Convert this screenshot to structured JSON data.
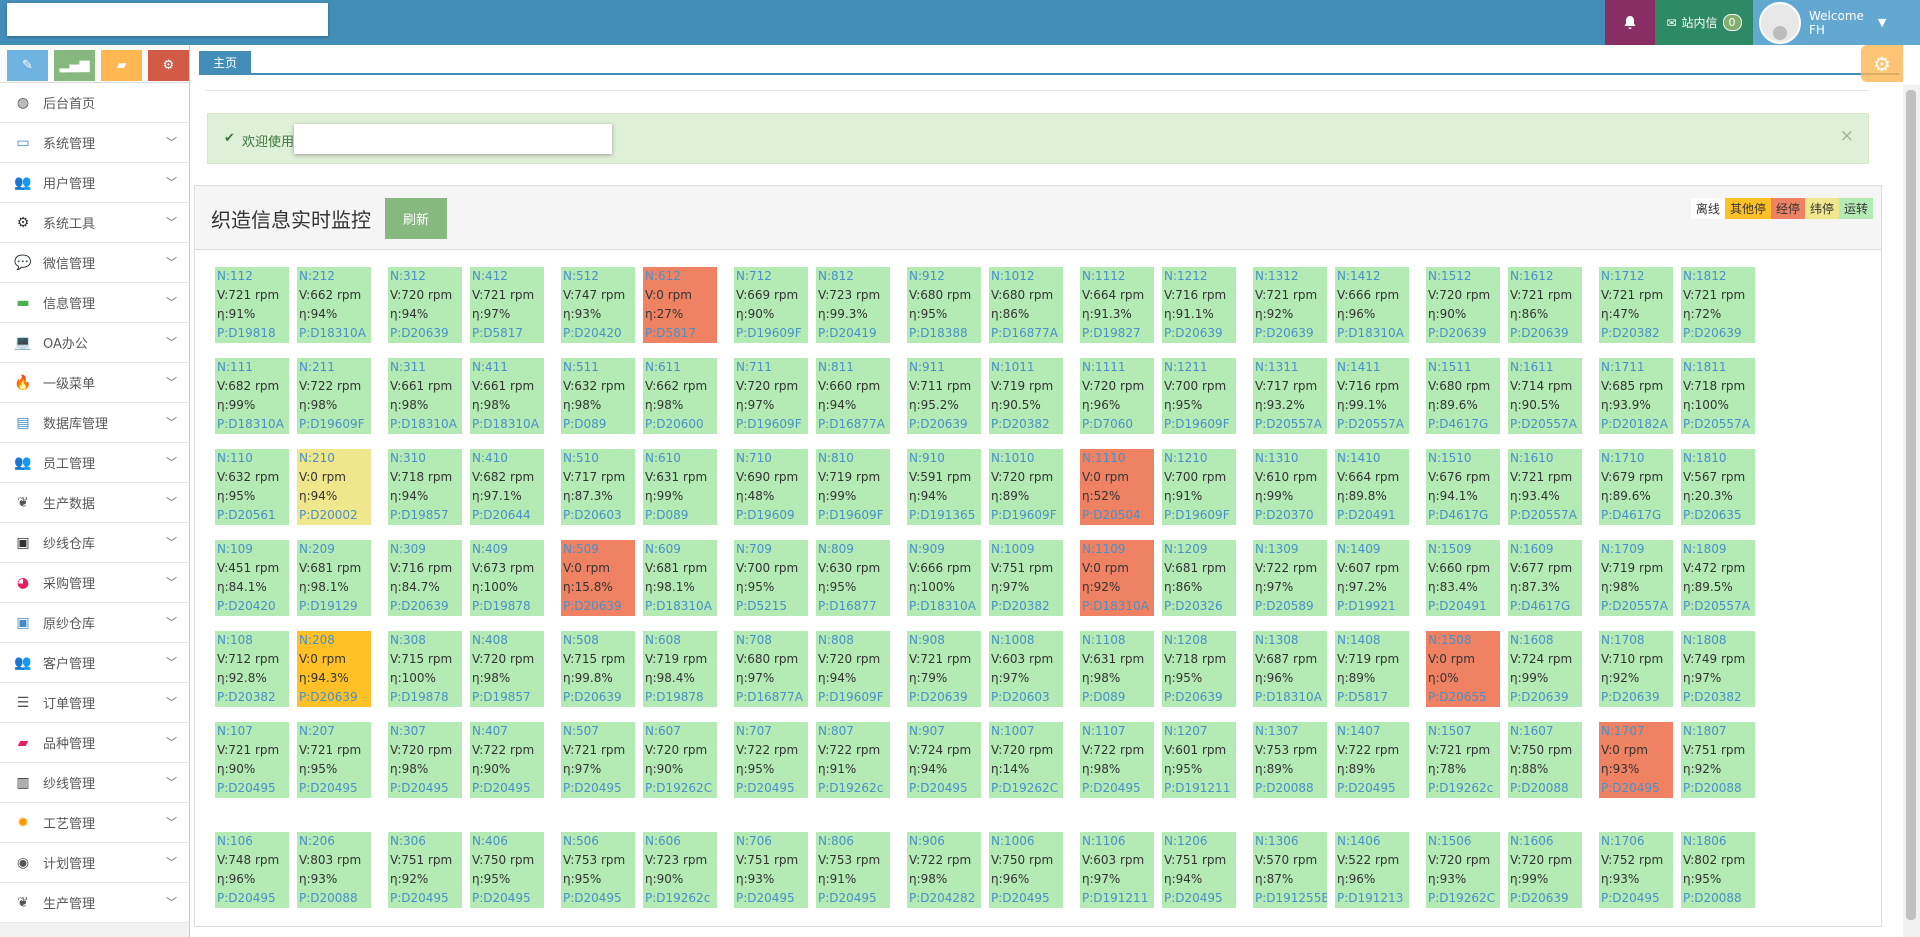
{
  "colors": {
    "normal": "#b4ebb4",
    "stopped": "#f08264",
    "yellow": "#f0e68c",
    "orange": "#ffc125",
    "gray": "#eeeeee"
  },
  "nav": {
    "message_label": "站内信",
    "message_count": "0",
    "welcome": "Welcome",
    "user": "FH"
  },
  "tab": {
    "home": "主页"
  },
  "alert": {
    "text": "欢迎使用"
  },
  "panel": {
    "title": "织造信息实时监控",
    "refresh": "刷新"
  },
  "legend": [
    {
      "label": "离线",
      "color": "#ffffff"
    },
    {
      "label": "其他停",
      "color": "#ffc125"
    },
    {
      "label": "经停",
      "color": "#f08264"
    },
    {
      "label": "纬停",
      "color": "#f0e68c"
    },
    {
      "label": "运转",
      "color": "#b4ebb4"
    }
  ],
  "sidebar": {
    "items": [
      {
        "label": "后台首页",
        "icon": "dashboard-icon",
        "glyph": "◍",
        "color": "#555",
        "caret": false
      },
      {
        "label": "系统管理",
        "icon": "desktop-icon",
        "glyph": "▭",
        "color": "#428bca",
        "caret": true
      },
      {
        "label": "用户管理",
        "icon": "users-icon",
        "glyph": "👥",
        "color": "#428bca",
        "caret": true
      },
      {
        "label": "系统工具",
        "icon": "cog-icon",
        "glyph": "⚙",
        "color": "#333",
        "caret": true
      },
      {
        "label": "微信管理",
        "icon": "comments-icon",
        "glyph": "💬",
        "color": "#8b5fbf",
        "caret": true
      },
      {
        "label": "信息管理",
        "icon": "credit-card-icon",
        "glyph": "▬",
        "color": "#4caf50",
        "caret": true
      },
      {
        "label": "OA办公",
        "icon": "laptop-icon",
        "glyph": "💻",
        "color": "#e91e63",
        "caret": true
      },
      {
        "label": "一级菜单",
        "icon": "fire-icon",
        "glyph": "🔥",
        "color": "#ff5722",
        "caret": true
      },
      {
        "label": "数据库管理",
        "icon": "hdd-icon",
        "glyph": "▤",
        "color": "#428bca",
        "caret": true
      },
      {
        "label": "员工管理",
        "icon": "users-icon",
        "glyph": "👥",
        "color": "#428bca",
        "caret": true
      },
      {
        "label": "生产数据",
        "icon": "leaf-icon",
        "glyph": "❦",
        "color": "#555",
        "caret": true
      },
      {
        "label": "纱线仓库",
        "icon": "briefcase-icon",
        "glyph": "▣",
        "color": "#333",
        "caret": true
      },
      {
        "label": "采购管理",
        "icon": "palette-icon",
        "glyph": "◕",
        "color": "#e91e63",
        "caret": true
      },
      {
        "label": "原纱仓库",
        "icon": "briefcase-icon",
        "glyph": "▣",
        "color": "#428bca",
        "caret": true
      },
      {
        "label": "客户管理",
        "icon": "users-icon",
        "glyph": "👥",
        "color": "#e91e63",
        "caret": true
      },
      {
        "label": "订单管理",
        "icon": "file-icon",
        "glyph": "☰",
        "color": "#555",
        "caret": true
      },
      {
        "label": "品种管理",
        "icon": "book-icon",
        "glyph": "▰",
        "color": "#e91e63",
        "caret": true
      },
      {
        "label": "纱线管理",
        "icon": "barcode-icon",
        "glyph": "▥",
        "color": "#333",
        "caret": true
      },
      {
        "label": "工艺管理",
        "icon": "gear-orange-icon",
        "glyph": "✹",
        "color": "#ff9800",
        "caret": true
      },
      {
        "label": "计划管理",
        "icon": "globe-icon",
        "glyph": "◉",
        "color": "#555",
        "caret": true
      },
      {
        "label": "生产管理",
        "icon": "leaf-icon",
        "glyph": "❦",
        "color": "#555",
        "caret": true
      }
    ]
  },
  "machines": [
    [
      [
        "N:112",
        "V:721 rpm",
        "η:91%",
        "P:D19818",
        "normal"
      ],
      [
        "N:212",
        "V:662 rpm",
        "η:94%",
        "P:D18310A",
        "normal"
      ],
      [
        "N:312",
        "V:720 rpm",
        "η:94%",
        "P:D20639",
        "normal"
      ],
      [
        "N:412",
        "V:721 rpm",
        "η:97%",
        "P:D5817",
        "normal"
      ],
      [
        "N:512",
        "V:747 rpm",
        "η:93%",
        "P:D20420",
        "normal"
      ],
      [
        "N:612",
        "V:0 rpm",
        "η:27%",
        "P:D5817",
        "stopped"
      ],
      [
        "N:712",
        "V:669 rpm",
        "η:90%",
        "P:D19609F",
        "normal"
      ],
      [
        "N:812",
        "V:723 rpm",
        "η:99.3%",
        "P:D20419",
        "normal"
      ],
      [
        "N:912",
        "V:680 rpm",
        "η:95%",
        "P:D18388",
        "normal"
      ],
      [
        "N:1012",
        "V:680 rpm",
        "η:86%",
        "P:D16877A",
        "normal"
      ],
      [
        "N:1112",
        "V:664 rpm",
        "η:91.3%",
        "P:D19827",
        "normal"
      ],
      [
        "N:1212",
        "V:716 rpm",
        "η:91.1%",
        "P:D20639",
        "normal"
      ],
      [
        "N:1312",
        "V:721 rpm",
        "η:92%",
        "P:D20639",
        "normal"
      ],
      [
        "N:1412",
        "V:666 rpm",
        "η:96%",
        "P:D18310A",
        "normal"
      ],
      [
        "N:1512",
        "V:720 rpm",
        "η:90%",
        "P:D20639",
        "normal"
      ],
      [
        "N:1612",
        "V:721 rpm",
        "η:86%",
        "P:D20639",
        "normal"
      ],
      [
        "N:1712",
        "V:721 rpm",
        "η:47%",
        "P:D20382",
        "normal"
      ],
      [
        "N:1812",
        "V:721 rpm",
        "η:72%",
        "P:D20639",
        "normal"
      ]
    ],
    [
      [
        "N:111",
        "V:682 rpm",
        "η:99%",
        "P:D18310A",
        "normal"
      ],
      [
        "N:211",
        "V:722 rpm",
        "η:98%",
        "P:D19609F",
        "normal"
      ],
      [
        "N:311",
        "V:661 rpm",
        "η:98%",
        "P:D18310A",
        "normal"
      ],
      [
        "N:411",
        "V:661 rpm",
        "η:98%",
        "P:D18310A",
        "normal"
      ],
      [
        "N:511",
        "V:632 rpm",
        "η:98%",
        "P:D089",
        "normal"
      ],
      [
        "N:611",
        "V:662 rpm",
        "η:98%",
        "P:D20600",
        "normal"
      ],
      [
        "N:711",
        "V:720 rpm",
        "η:97%",
        "P:D19609F",
        "normal"
      ],
      [
        "N:811",
        "V:660 rpm",
        "η:94%",
        "P:D16877A",
        "normal"
      ],
      [
        "N:911",
        "V:711 rpm",
        "η:95.2%",
        "P:D20639",
        "normal"
      ],
      [
        "N:1011",
        "V:719 rpm",
        "η:90.5%",
        "P:D20382",
        "normal"
      ],
      [
        "N:1111",
        "V:720 rpm",
        "η:96%",
        "P:D7060",
        "normal"
      ],
      [
        "N:1211",
        "V:700 rpm",
        "η:95%",
        "P:D19609F",
        "normal"
      ],
      [
        "N:1311",
        "V:717 rpm",
        "η:93.2%",
        "P:D20557A",
        "normal"
      ],
      [
        "N:1411",
        "V:716 rpm",
        "η:99.1%",
        "P:D20557A",
        "normal"
      ],
      [
        "N:1511",
        "V:680 rpm",
        "η:89.6%",
        "P:D4617G",
        "normal"
      ],
      [
        "N:1611",
        "V:714 rpm",
        "η:90.5%",
        "P:D20557A",
        "normal"
      ],
      [
        "N:1711",
        "V:685 rpm",
        "η:93.9%",
        "P:D20182A",
        "normal"
      ],
      [
        "N:1811",
        "V:718 rpm",
        "η:100%",
        "P:D20557A",
        "normal"
      ]
    ],
    [
      [
        "N:110",
        "V:632 rpm",
        "η:95%",
        "P:D20561",
        "normal"
      ],
      [
        "N:210",
        "V:0 rpm",
        "η:94%",
        "P:D20002",
        "yellow"
      ],
      [
        "N:310",
        "V:718 rpm",
        "η:94%",
        "P:D19857",
        "normal"
      ],
      [
        "N:410",
        "V:682 rpm",
        "η:97.1%",
        "P:D20644",
        "normal"
      ],
      [
        "N:510",
        "V:717 rpm",
        "η:87.3%",
        "P:D20603",
        "normal"
      ],
      [
        "N:610",
        "V:631 rpm",
        "η:99%",
        "P:D089",
        "normal"
      ],
      [
        "N:710",
        "V:690 rpm",
        "η:48%",
        "P:D19609",
        "normal"
      ],
      [
        "N:810",
        "V:719 rpm",
        "η:99%",
        "P:D19609F",
        "normal"
      ],
      [
        "N:910",
        "V:591 rpm",
        "η:94%",
        "P:D191365",
        "normal"
      ],
      [
        "N:1010",
        "V:720 rpm",
        "η:89%",
        "P:D19609F",
        "normal"
      ],
      [
        "N:1110",
        "V:0 rpm",
        "η:52%",
        "P:D20504",
        "stopped"
      ],
      [
        "N:1210",
        "V:700 rpm",
        "η:91%",
        "P:D19609F",
        "normal"
      ],
      [
        "N:1310",
        "V:610 rpm",
        "η:99%",
        "P:D20370",
        "normal"
      ],
      [
        "N:1410",
        "V:664 rpm",
        "η:89.8%",
        "P:D20491",
        "normal"
      ],
      [
        "N:1510",
        "V:676 rpm",
        "η:94.1%",
        "P:D4617G",
        "normal"
      ],
      [
        "N:1610",
        "V:721 rpm",
        "η:93.4%",
        "P:D20557A",
        "normal"
      ],
      [
        "N:1710",
        "V:679 rpm",
        "η:89.6%",
        "P:D4617G",
        "normal"
      ],
      [
        "N:1810",
        "V:567 rpm",
        "η:20.3%",
        "P:D20635",
        "normal"
      ]
    ],
    [
      [
        "N:109",
        "V:451 rpm",
        "η:84.1%",
        "P:D20420",
        "normal"
      ],
      [
        "N:209",
        "V:681 rpm",
        "η:98.1%",
        "P:D19129",
        "normal"
      ],
      [
        "N:309",
        "V:716 rpm",
        "η:84.7%",
        "P:D20639",
        "normal"
      ],
      [
        "N:409",
        "V:673 rpm",
        "η:100%",
        "P:D19878",
        "normal"
      ],
      [
        "N:509",
        "V:0 rpm",
        "η:15.8%",
        "P:D20639",
        "stopped"
      ],
      [
        "N:609",
        "V:681 rpm",
        "η:98.1%",
        "P:D18310A",
        "normal"
      ],
      [
        "N:709",
        "V:700 rpm",
        "η:95%",
        "P:D5215",
        "normal"
      ],
      [
        "N:809",
        "V:630 rpm",
        "η:95%",
        "P:D16877",
        "normal"
      ],
      [
        "N:909",
        "V:666 rpm",
        "η:100%",
        "P:D18310A",
        "normal"
      ],
      [
        "N:1009",
        "V:751 rpm",
        "η:97%",
        "P:D20382",
        "normal"
      ],
      [
        "N:1109",
        "V:0 rpm",
        "η:92%",
        "P:D18310A",
        "stopped"
      ],
      [
        "N:1209",
        "V:681 rpm",
        "η:86%",
        "P:D20326",
        "normal"
      ],
      [
        "N:1309",
        "V:722 rpm",
        "η:97%",
        "P:D20589",
        "normal"
      ],
      [
        "N:1409",
        "V:607 rpm",
        "η:97.2%",
        "P:D19921",
        "normal"
      ],
      [
        "N:1509",
        "V:660 rpm",
        "η:83.4%",
        "P:D20491",
        "normal"
      ],
      [
        "N:1609",
        "V:677 rpm",
        "η:87.3%",
        "P:D4617G",
        "normal"
      ],
      [
        "N:1709",
        "V:719 rpm",
        "η:98%",
        "P:D20557A",
        "normal"
      ],
      [
        "N:1809",
        "V:472 rpm",
        "η:89.5%",
        "P:D20557A",
        "normal"
      ]
    ],
    [
      [
        "N:108",
        "V:712 rpm",
        "η:92.8%",
        "P:D20382",
        "normal"
      ],
      [
        "N:208",
        "V:0 rpm",
        "η:94.3%",
        "P:D20639",
        "orange"
      ],
      [
        "N:308",
        "V:715 rpm",
        "η:100%",
        "P:D19878",
        "normal"
      ],
      [
        "N:408",
        "V:720 rpm",
        "η:98%",
        "P:D19857",
        "normal"
      ],
      [
        "N:508",
        "V:715 rpm",
        "η:99.8%",
        "P:D20639",
        "normal"
      ],
      [
        "N:608",
        "V:719 rpm",
        "η:98.4%",
        "P:D19878",
        "normal"
      ],
      [
        "N:708",
        "V:680 rpm",
        "η:97%",
        "P:D16877A",
        "normal"
      ],
      [
        "N:808",
        "V:720 rpm",
        "η:94%",
        "P:D19609F",
        "normal"
      ],
      [
        "N:908",
        "V:721 rpm",
        "η:79%",
        "P:D20639",
        "normal"
      ],
      [
        "N:1008",
        "V:603 rpm",
        "η:97%",
        "P:D20603",
        "normal"
      ],
      [
        "N:1108",
        "V:631 rpm",
        "η:98%",
        "P:D089",
        "normal"
      ],
      [
        "N:1208",
        "V:718 rpm",
        "η:95%",
        "P:D20639",
        "normal"
      ],
      [
        "N:1308",
        "V:687 rpm",
        "η:96%",
        "P:D18310A",
        "normal"
      ],
      [
        "N:1408",
        "V:719 rpm",
        "η:89%",
        "P:D5817",
        "normal"
      ],
      [
        "N:1508",
        "V:0 rpm",
        "η:0%",
        "P:D20655",
        "stopped"
      ],
      [
        "N:1608",
        "V:724 rpm",
        "η:99%",
        "P:D20639",
        "normal"
      ],
      [
        "N:1708",
        "V:710 rpm",
        "η:92%",
        "P:D20639",
        "normal"
      ],
      [
        "N:1808",
        "V:749 rpm",
        "η:97%",
        "P:D20382",
        "normal"
      ]
    ],
    [
      [
        "N:107",
        "V:721 rpm",
        "η:90%",
        "P:D20495",
        "normal"
      ],
      [
        "N:207",
        "V:721 rpm",
        "η:95%",
        "P:D20495",
        "normal"
      ],
      [
        "N:307",
        "V:720 rpm",
        "η:98%",
        "P:D20495",
        "normal"
      ],
      [
        "N:407",
        "V:722 rpm",
        "η:90%",
        "P:D20495",
        "normal"
      ],
      [
        "N:507",
        "V:721 rpm",
        "η:97%",
        "P:D20495",
        "normal"
      ],
      [
        "N:607",
        "V:720 rpm",
        "η:90%",
        "P:D19262C",
        "normal"
      ],
      [
        "N:707",
        "V:722 rpm",
        "η:95%",
        "P:D20495",
        "normal"
      ],
      [
        "N:807",
        "V:722 rpm",
        "η:91%",
        "P:D19262c",
        "normal"
      ],
      [
        "N:907",
        "V:724 rpm",
        "η:94%",
        "P:D20495",
        "normal"
      ],
      [
        "N:1007",
        "V:720 rpm",
        "η:14%",
        "P:D19262C",
        "normal"
      ],
      [
        "N:1107",
        "V:722 rpm",
        "η:98%",
        "P:D20495",
        "normal"
      ],
      [
        "N:1207",
        "V:601 rpm",
        "η:95%",
        "P:D191211",
        "normal"
      ],
      [
        "N:1307",
        "V:753 rpm",
        "η:89%",
        "P:D20088",
        "normal"
      ],
      [
        "N:1407",
        "V:722 rpm",
        "η:89%",
        "P:D20495",
        "normal"
      ],
      [
        "N:1507",
        "V:721 rpm",
        "η:78%",
        "P:D19262c",
        "normal"
      ],
      [
        "N:1607",
        "V:750 rpm",
        "η:88%",
        "P:D20088",
        "normal"
      ],
      [
        "N:1707",
        "V:0 rpm",
        "η:93%",
        "P:D20495",
        "stopped"
      ],
      [
        "N:1807",
        "V:751 rpm",
        "η:92%",
        "P:D20088",
        "normal"
      ]
    ],
    [
      [
        "N:106",
        "V:748 rpm",
        "η:96%",
        "P:D20495",
        "normal"
      ],
      [
        "N:206",
        "V:803 rpm",
        "η:93%",
        "P:D20088",
        "normal"
      ],
      [
        "N:306",
        "V:751 rpm",
        "η:92%",
        "P:D20495",
        "normal"
      ],
      [
        "N:406",
        "V:750 rpm",
        "η:95%",
        "P:D20495",
        "normal"
      ],
      [
        "N:506",
        "V:753 rpm",
        "η:95%",
        "P:D20495",
        "normal"
      ],
      [
        "N:606",
        "V:723 rpm",
        "η:90%",
        "P:D19262c",
        "normal"
      ],
      [
        "N:706",
        "V:751 rpm",
        "η:93%",
        "P:D20495",
        "normal"
      ],
      [
        "N:806",
        "V:753 rpm",
        "η:91%",
        "P:D20495",
        "normal"
      ],
      [
        "N:906",
        "V:722 rpm",
        "η:98%",
        "P:D204282",
        "normal"
      ],
      [
        "N:1006",
        "V:750 rpm",
        "η:96%",
        "P:D20495",
        "normal"
      ],
      [
        "N:1106",
        "V:603 rpm",
        "η:97%",
        "P:D191211",
        "normal"
      ],
      [
        "N:1206",
        "V:751 rpm",
        "η:94%",
        "P:D20495",
        "normal"
      ],
      [
        "N:1306",
        "V:570 rpm",
        "η:87%",
        "P:D191255B",
        "normal"
      ],
      [
        "N:1406",
        "V:522 rpm",
        "η:96%",
        "P:D191213",
        "normal"
      ],
      [
        "N:1506",
        "V:720 rpm",
        "η:93%",
        "P:D19262C",
        "normal"
      ],
      [
        "N:1606",
        "V:720 rpm",
        "η:99%",
        "P:D20639",
        "normal"
      ],
      [
        "N:1706",
        "V:752 rpm",
        "η:93%",
        "P:D20495",
        "normal"
      ],
      [
        "N:1806",
        "V:802 rpm",
        "η:95%",
        "P:D20088",
        "normal"
      ]
    ]
  ]
}
